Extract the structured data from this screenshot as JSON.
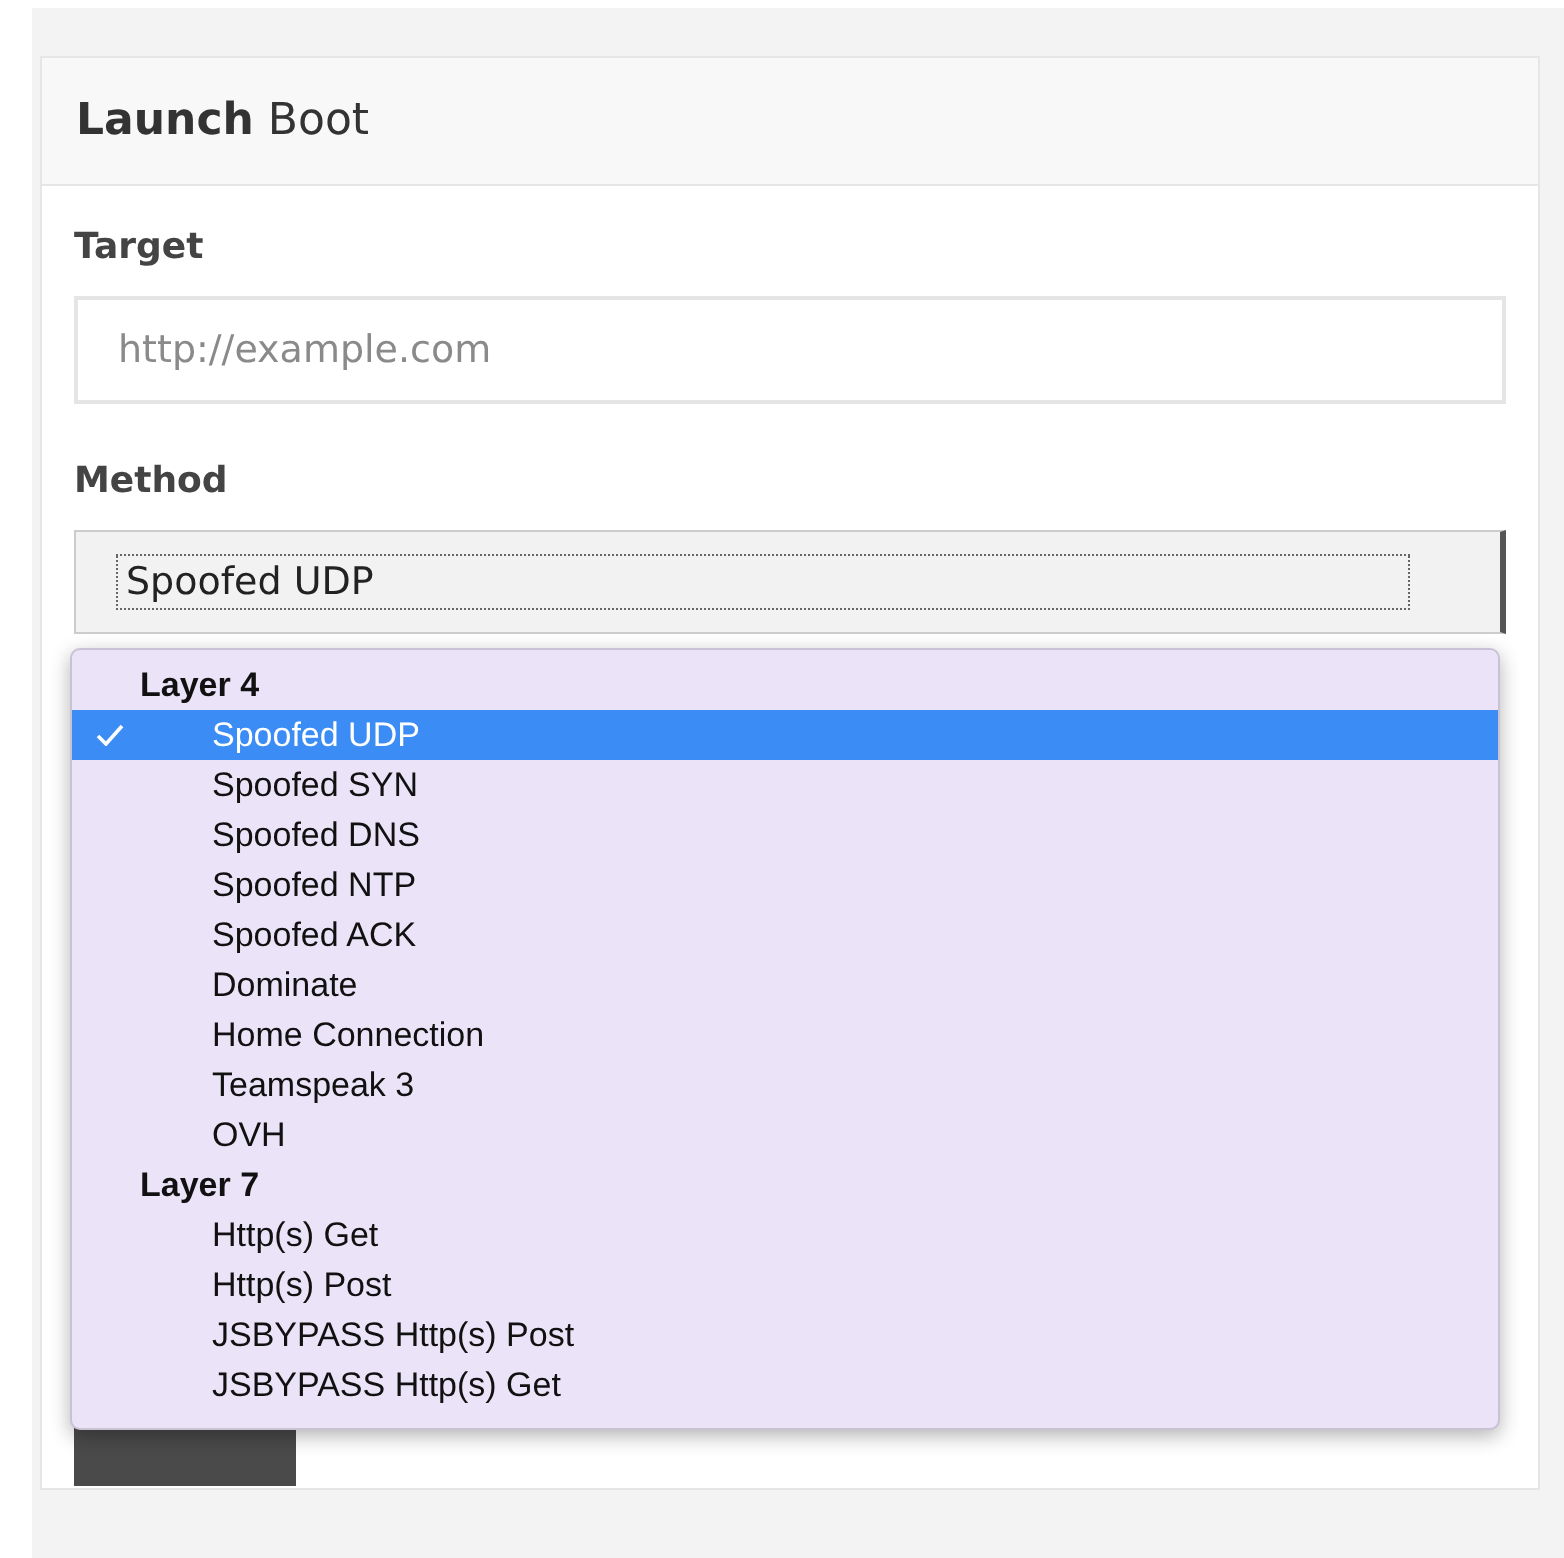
{
  "panel": {
    "title_bold": "Launch",
    "title_rest": "Boot"
  },
  "target": {
    "label": "Target",
    "placeholder": "http://example.com"
  },
  "method": {
    "label": "Method",
    "value": "Spoofed UDP"
  },
  "dropdown": {
    "groups": [
      {
        "label": "Layer 4",
        "options": [
          {
            "label": "Spoofed UDP",
            "selected": true
          },
          {
            "label": "Spoofed SYN",
            "selected": false
          },
          {
            "label": "Spoofed DNS",
            "selected": false
          },
          {
            "label": "Spoofed NTP",
            "selected": false
          },
          {
            "label": "Spoofed ACK",
            "selected": false
          },
          {
            "label": "Dominate",
            "selected": false
          },
          {
            "label": "Home Connection",
            "selected": false
          },
          {
            "label": "Teamspeak 3",
            "selected": false
          },
          {
            "label": "OVH",
            "selected": false
          }
        ]
      },
      {
        "label": "Layer 7",
        "options": [
          {
            "label": "Http(s) Get",
            "selected": false
          },
          {
            "label": "Http(s) Post",
            "selected": false
          },
          {
            "label": "JSBYPASS Http(s) Post",
            "selected": false
          },
          {
            "label": "JSBYPASS Http(s) Get",
            "selected": false
          }
        ]
      }
    ]
  }
}
